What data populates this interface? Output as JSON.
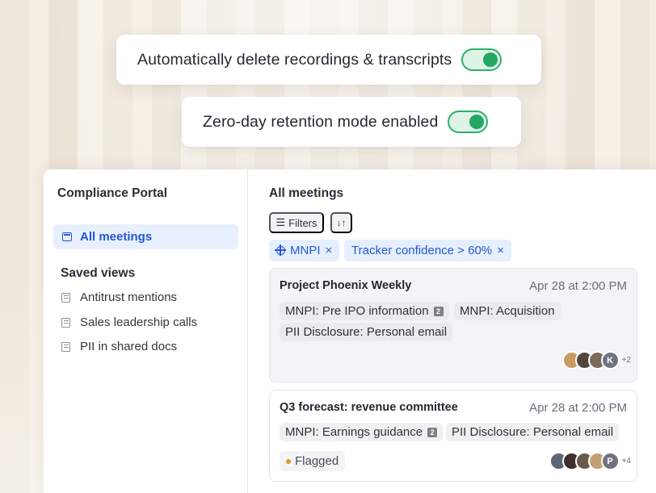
{
  "toggles": [
    {
      "label": "Automatically delete recordings & transcripts",
      "state": "on"
    },
    {
      "label": "Zero-day retention mode enabled",
      "state": "on"
    }
  ],
  "sidebar": {
    "title": "Compliance Portal",
    "active_item": {
      "label": "All meetings",
      "icon": "calendar-icon"
    },
    "saved_views_title": "Saved views",
    "saved_views": [
      {
        "label": "Antitrust mentions",
        "icon": "list-icon"
      },
      {
        "label": "Sales leadership calls",
        "icon": "list-icon"
      },
      {
        "label": "PII in shared docs",
        "icon": "list-icon"
      }
    ]
  },
  "main": {
    "title": "All meetings",
    "filters_label": "Filters",
    "sort_icon": "↓↑",
    "filter_chips": [
      {
        "label": "MNPI",
        "icon": "target-icon",
        "close": "×"
      },
      {
        "label": "Tracker confidence > 60%",
        "close": "×"
      }
    ],
    "meetings": [
      {
        "title": "Project Phoenix Weekly",
        "time": "Apr 28 at 2:00 PM",
        "tags": [
          {
            "label": "MNPI: Pre IPO information",
            "badge": "2"
          },
          {
            "label": "MNPI: Acquisition"
          },
          {
            "label": "PII Disclosure: Personal email"
          }
        ],
        "avatars": {
          "initial": "K",
          "more": "+2"
        }
      },
      {
        "title": "Q3 forecast: revenue committee",
        "time": "Apr 28 at 2:00 PM",
        "tags": [
          {
            "label": "MNPI: Earnings guidance",
            "badge": "2"
          },
          {
            "label": "PII Disclosure: Personal email"
          }
        ],
        "status": "Flagged",
        "avatars": {
          "initial": "P",
          "more": "+4"
        }
      }
    ]
  },
  "colors": {
    "accent": "#2557d6",
    "toggle_on": "#23a862",
    "flag_dot": "#e1962c"
  }
}
